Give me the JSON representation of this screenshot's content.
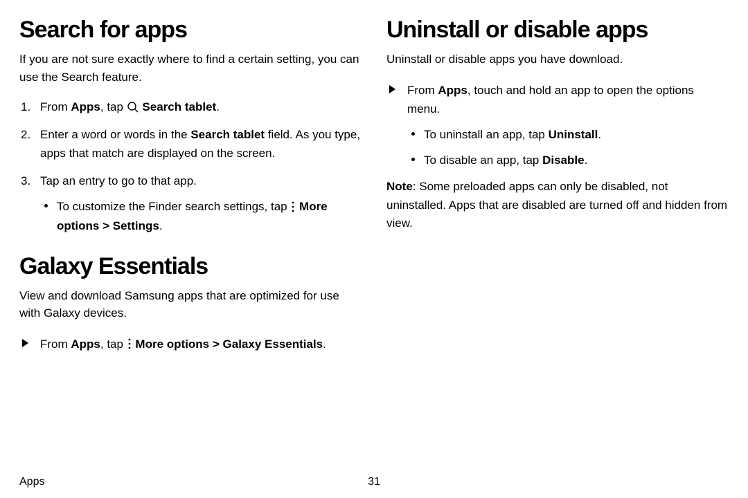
{
  "left": {
    "h1a": "Search for apps",
    "intro_a": "If you are not sure exactly where to find a certain setting, you can use the Search feature.",
    "li1_pre": "From ",
    "li1_apps": "Apps",
    "li1_mid": ", tap ",
    "li1_search": " Search tablet",
    "li1_end": ".",
    "li2_a": "Enter a word or words in the ",
    "li2_b": "Search tablet",
    "li2_c": " field. As you type, apps that match are displayed on the screen.",
    "li3": "Tap an entry to go to that app.",
    "li3_sub_a": "To customize the Finder search settings, tap ",
    "li3_sub_more": " More options",
    "li3_sub_gt": " > ",
    "li3_sub_settings": "Settings",
    "li3_sub_end": ".",
    "h1b": "Galaxy Essentials",
    "intro_b": "View and download Samsung apps that are optimized for use with Galaxy devices.",
    "ge_pre": "From ",
    "ge_apps": "Apps",
    "ge_mid": ", tap ",
    "ge_more": " More options",
    "ge_gt": " > ",
    "ge_ge": "Galaxy Essentials",
    "ge_end": "."
  },
  "right": {
    "h1": "Uninstall or disable apps",
    "intro": "Uninstall or disable apps you have download.",
    "li_pre": "From ",
    "li_apps": "Apps",
    "li_post": ", touch and hold an app to open the options menu.",
    "sub1_a": "To uninstall an app, tap ",
    "sub1_b": "Uninstall",
    "sub1_c": ".",
    "sub2_a": "To disable an app, tap ",
    "sub2_b": "Disable",
    "sub2_c": ".",
    "note_label": "Note",
    "note_body": ": Some preloaded apps can only be disabled, not uninstalled. Apps that are disabled are turned off and hidden from view."
  },
  "footer": {
    "chapter": "Apps",
    "page": "31"
  }
}
